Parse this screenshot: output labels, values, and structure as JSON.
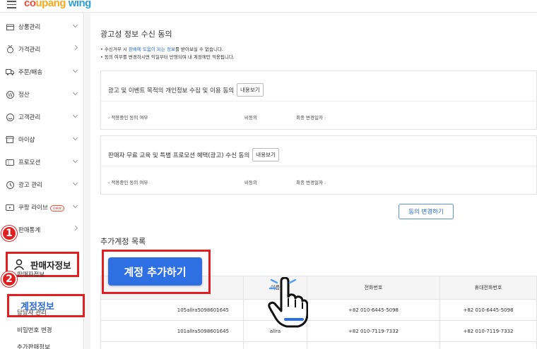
{
  "app": {
    "logo_parts": [
      "co",
      "upang",
      " ",
      "wing"
    ],
    "logo_colors": [
      "#e94d3a",
      "#f7a81b",
      "#7bbf3a",
      "#2a9fd8"
    ]
  },
  "sidebar": {
    "items": [
      {
        "label": "상품관리",
        "icon": "box-icon"
      },
      {
        "label": "가격관리",
        "icon": "medal-icon"
      },
      {
        "label": "주문/배송",
        "icon": "truck-icon"
      },
      {
        "label": "정산",
        "icon": "won-icon"
      },
      {
        "label": "고객관리",
        "icon": "smile-icon"
      },
      {
        "label": "마이샵",
        "icon": "shop-icon"
      },
      {
        "label": "프로모션",
        "icon": "ticket-icon"
      },
      {
        "label": "광고 관리",
        "icon": "clock-icon"
      },
      {
        "label": "쿠팡 라이브",
        "icon": "live-icon",
        "badge": "new"
      },
      {
        "label": "판매통계",
        "icon": "chart-icon"
      }
    ],
    "seller_info": {
      "label": "판매자정보",
      "step": "1"
    },
    "sub_items": {
      "seller_detail": "판매자정보",
      "manager": "담당자 관리",
      "password": "비밀번호 변경",
      "more": "추가판매정보"
    },
    "account_info": {
      "label": "계정정보",
      "step": "2"
    }
  },
  "main": {
    "title": "광고성 정보 수신 동의",
    "notes": {
      "line1_pre": "• 수신거부 시 ",
      "line1_link": "판매에 도움이 되는 정보",
      "line1_post": "를 받아보실 수 없습니다.",
      "line2": "• 동의 여부를 변경하시면 익일부터 반영되며 내 계정에만 적용됩니다."
    },
    "cards": [
      {
        "title": "광고 및 이벤트 목적의 개인정보 수집 및 이용 동의",
        "detail_label": "내용보기",
        "status_label": "- 적용중인 동의 여부",
        "status_value": "비동의",
        "changed_label": "최종 변경일자 :"
      },
      {
        "title": "판매자 무료 교육 및 특별 프로모션 혜택(광고) 수신 동의",
        "detail_label": "내용보기",
        "status_label": "- 적용중인 동의 여부",
        "status_value": "비동의",
        "changed_label": "최종 변경일자 :"
      }
    ],
    "change_button": "동의 변경하기",
    "accounts_title": "추가계정 목록",
    "add_account_button": "계정 추가하기",
    "table": {
      "headers": [
        "",
        "이름",
        "전화번호",
        "휴대전화번호"
      ],
      "rows": [
        [
          "105allra5098601645",
          "allra",
          "+82 010-6445-5098",
          "+82 010-6445-5098"
        ],
        [
          "101allra5098601645",
          "allra",
          "+82 010-7119-7332",
          "+82 010-7119-7332"
        ]
      ]
    }
  }
}
